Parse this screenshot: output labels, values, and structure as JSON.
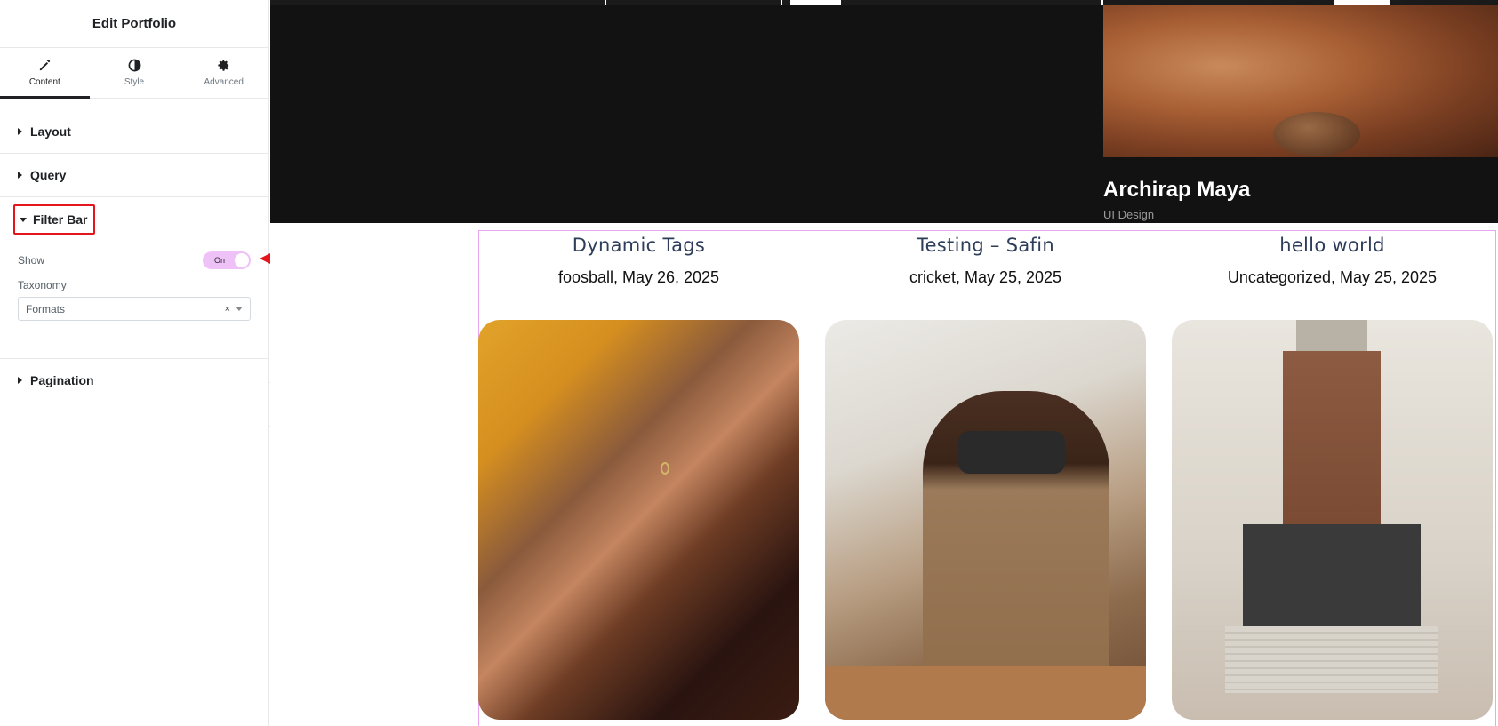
{
  "panel": {
    "title": "Edit Portfolio",
    "tabs": [
      {
        "label": "Content",
        "icon": "pencil-icon",
        "active": true
      },
      {
        "label": "Style",
        "icon": "half-circle-icon",
        "active": false
      },
      {
        "label": "Advanced",
        "icon": "gear-icon",
        "active": false
      }
    ],
    "sections": {
      "layout": "Layout",
      "query": "Query",
      "filter_bar": "Filter Bar",
      "pagination": "Pagination"
    },
    "filter_bar": {
      "show_label": "Show",
      "show_toggle": "On",
      "taxonomy_label": "Taxonomy",
      "taxonomy_value": "Formats",
      "clear_glyph": "×"
    }
  },
  "preview": {
    "hero": {
      "title": "Archirap Maya",
      "subtitle": "UI Design"
    },
    "cards": [
      {
        "title": "Dynamic Tags",
        "meta": "foosball,  May 26, 2025",
        "image": "team-hands-image"
      },
      {
        "title": "Testing – Safin",
        "meta": "cricket,  May 25, 2025",
        "image": "vr-headset-image"
      },
      {
        "title": "hello world",
        "meta": "Uncategorized,  May 25, 2025",
        "image": "building-image"
      }
    ]
  },
  "colors": {
    "accent_pink": "#efc2f7",
    "highlight_red": "#e3151d",
    "frame_pink": "#e8a5f0"
  }
}
